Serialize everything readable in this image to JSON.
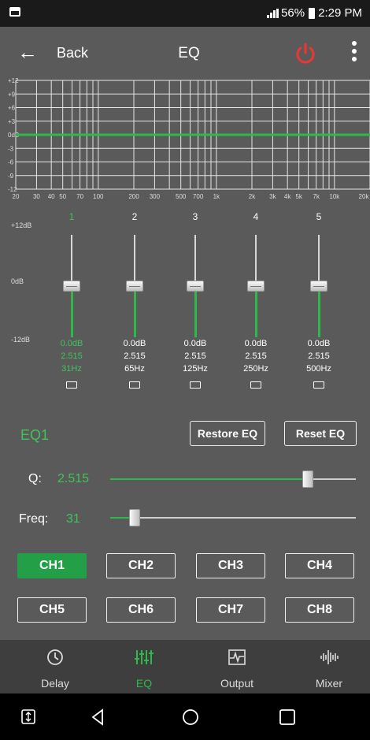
{
  "status_bar": {
    "battery": "56%",
    "time": "2:29 PM"
  },
  "topbar": {
    "back_label": "Back",
    "title": "EQ"
  },
  "graph": {
    "y_labels": [
      "+12",
      "+9",
      "+6",
      "+3",
      "0dB",
      "-3",
      "-6",
      "-9",
      "-12"
    ],
    "x_labels": [
      "20",
      "30",
      "40",
      "50",
      "70",
      "100",
      "200",
      "300",
      "500",
      "700",
      "1k",
      "2k",
      "3k",
      "4k",
      "5k",
      "7k",
      "10k",
      "20k"
    ],
    "curve_db": 0,
    "curve_color": "#2fb84b"
  },
  "eq": {
    "db_labels": {
      "top": "+12dB",
      "mid": "0dB",
      "bottom": "-12dB"
    },
    "bands": [
      {
        "num": "1",
        "gain": "0.0dB",
        "q": "2.515",
        "freq": "31Hz",
        "level": 0.5,
        "active": true
      },
      {
        "num": "2",
        "gain": "0.0dB",
        "q": "2.515",
        "freq": "65Hz",
        "level": 0.5,
        "active": false
      },
      {
        "num": "3",
        "gain": "0.0dB",
        "q": "2.515",
        "freq": "125Hz",
        "level": 0.5,
        "active": false
      },
      {
        "num": "4",
        "gain": "0.0dB",
        "q": "2.515",
        "freq": "250Hz",
        "level": 0.5,
        "active": false
      },
      {
        "num": "5",
        "gain": "0.0dB",
        "q": "2.515",
        "freq": "500Hz",
        "level": 0.5,
        "active": false
      }
    ],
    "name": "EQ1",
    "restore_label": "Restore EQ",
    "reset_label": "Reset EQ",
    "q_label": "Q:",
    "q_value": "2.515",
    "q_position": 0.82,
    "freq_label": "Freq:",
    "freq_value": "31",
    "freq_position": 0.08
  },
  "channels": [
    {
      "label": "CH1",
      "active": true
    },
    {
      "label": "CH2",
      "active": false
    },
    {
      "label": "CH3",
      "active": false
    },
    {
      "label": "CH4",
      "active": false
    },
    {
      "label": "CH5",
      "active": false
    },
    {
      "label": "CH6",
      "active": false
    },
    {
      "label": "CH7",
      "active": false
    },
    {
      "label": "CH8",
      "active": false
    }
  ],
  "bottom_nav": [
    {
      "label": "Delay",
      "icon": "clock-icon",
      "active": false
    },
    {
      "label": "EQ",
      "icon": "equalizer-icon",
      "active": true
    },
    {
      "label": "Output",
      "icon": "output-wave-icon",
      "active": false
    },
    {
      "label": "Mixer",
      "icon": "waveform-icon",
      "active": false
    }
  ],
  "colors": {
    "accent": "#2fb84b",
    "background": "#5a5a5a",
    "power": "#e53935"
  }
}
